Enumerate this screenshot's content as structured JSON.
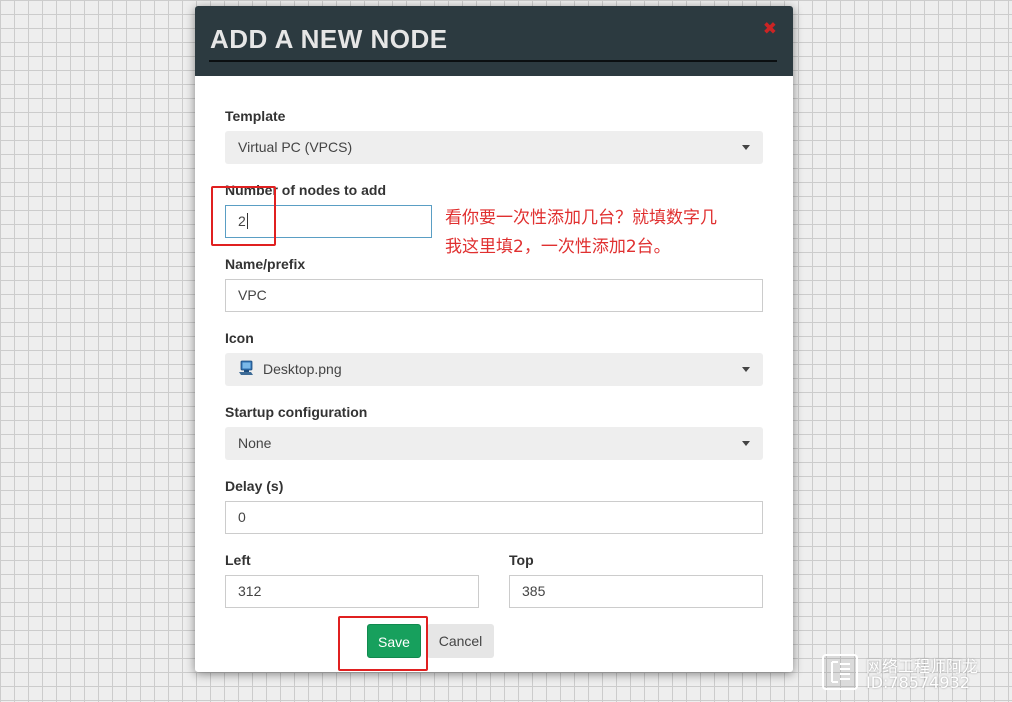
{
  "modal": {
    "title": "ADD A NEW NODE",
    "close_icon": "close-icon"
  },
  "form": {
    "template": {
      "label": "Template",
      "value": "Virtual PC (VPCS)"
    },
    "number_of_nodes": {
      "label": "Number of nodes to add",
      "value": "2"
    },
    "name_prefix": {
      "label": "Name/prefix",
      "value": "VPC"
    },
    "icon": {
      "label": "Icon",
      "value": "Desktop.png",
      "icon_name": "desktop-computer-icon"
    },
    "startup_config": {
      "label": "Startup configuration",
      "value": "None"
    },
    "delay": {
      "label": "Delay (s)",
      "value": "0"
    },
    "left": {
      "label": "Left",
      "value": "312"
    },
    "top": {
      "label": "Top",
      "value": "385"
    }
  },
  "buttons": {
    "save": "Save",
    "cancel": "Cancel"
  },
  "annotation": {
    "line1": "看你要一次性添加几台？就填数字几",
    "line2": "我这里填2，一次性添加2台。"
  },
  "watermark": {
    "line1": "网络工程师阿龙",
    "line2": "ID:78574932"
  },
  "colors": {
    "header_bg": "#2c3a40",
    "save_button": "#17a05d",
    "annotation_red": "#e03030"
  }
}
